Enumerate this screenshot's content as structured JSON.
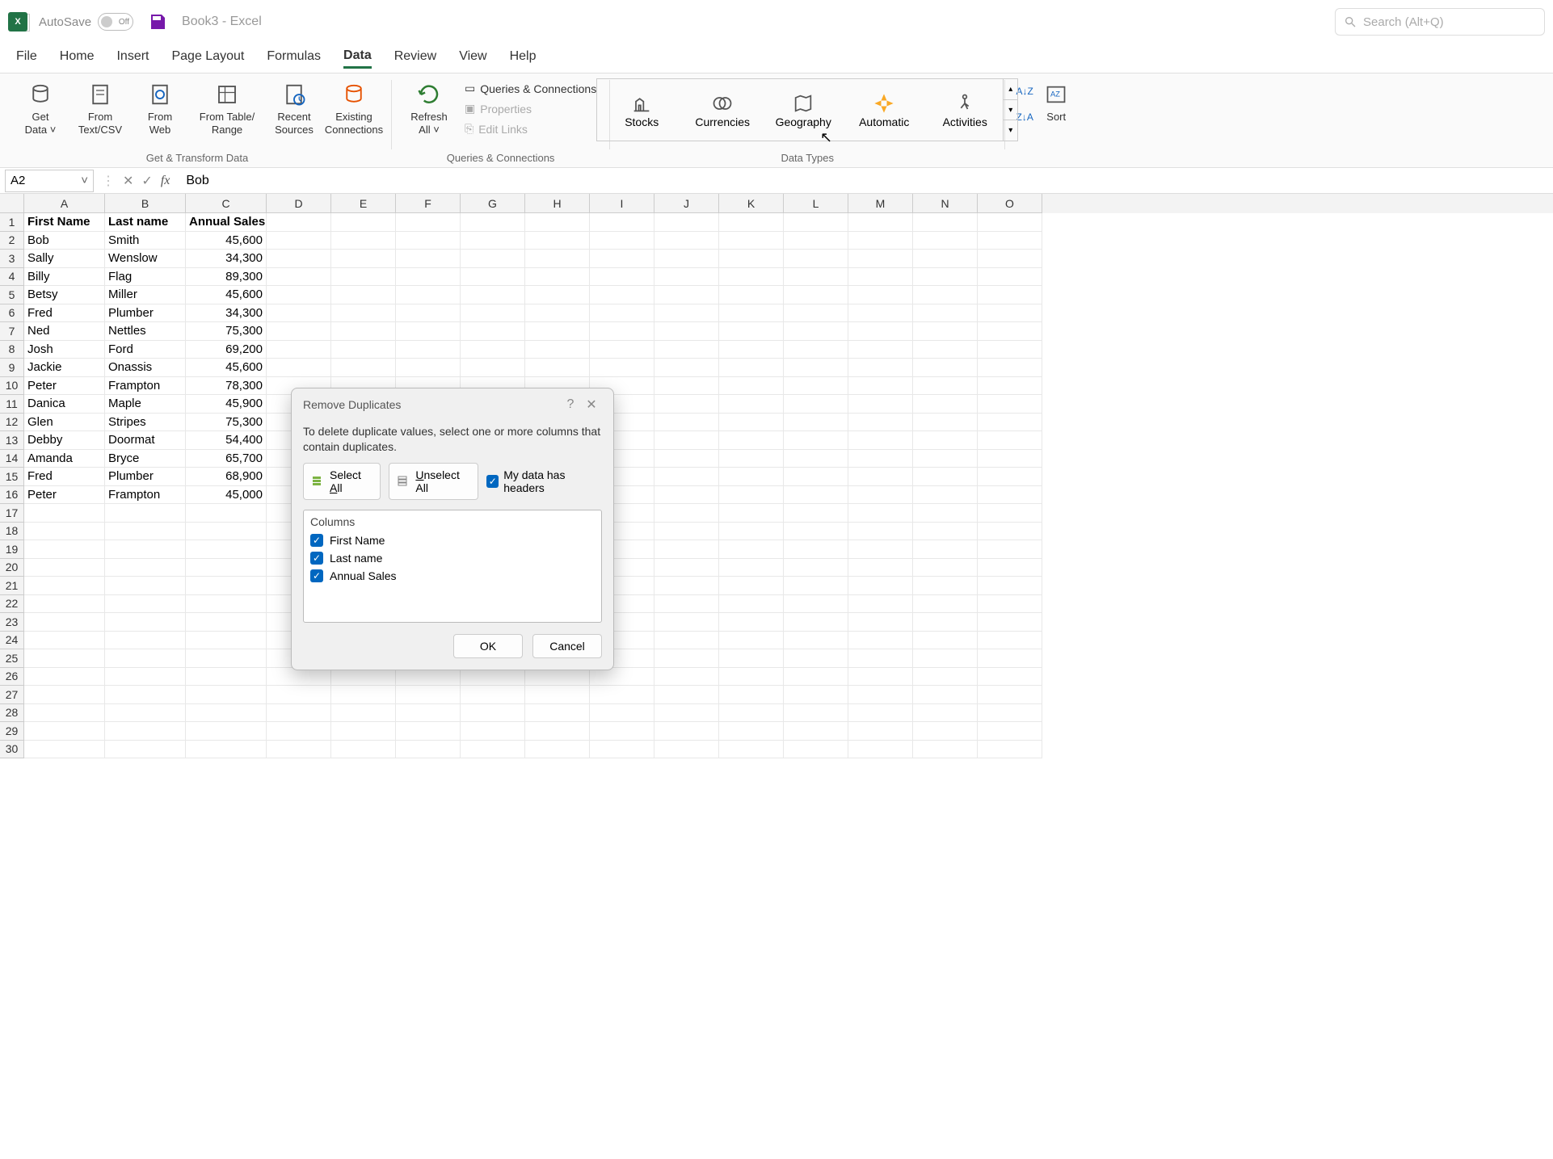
{
  "title": {
    "autosave": "AutoSave",
    "toggle": "Off",
    "doc": "Book3  -  Excel"
  },
  "search": {
    "placeholder": "Search (Alt+Q)"
  },
  "tabs": [
    "File",
    "Home",
    "Insert",
    "Page Layout",
    "Formulas",
    "Data",
    "Review",
    "View",
    "Help"
  ],
  "active_tab": "Data",
  "ribbon": {
    "get_transform": {
      "label": "Get & Transform Data",
      "items": [
        {
          "l1": "Get",
          "l2": "Data ˅"
        },
        {
          "l1": "From",
          "l2": "Text/CSV"
        },
        {
          "l1": "From",
          "l2": "Web"
        },
        {
          "l1": "From Table/",
          "l2": "Range"
        },
        {
          "l1": "Recent",
          "l2": "Sources"
        },
        {
          "l1": "Existing",
          "l2": "Connections"
        }
      ]
    },
    "queries": {
      "label": "Queries & Connections",
      "refresh": {
        "l1": "Refresh",
        "l2": "All ˅"
      },
      "links": [
        "Queries & Connections",
        "Properties",
        "Edit Links"
      ]
    },
    "datatypes": {
      "label": "Data Types",
      "items": [
        "Stocks",
        "Currencies",
        "Geography",
        "Automatic",
        "Activities"
      ]
    },
    "sort": "Sort"
  },
  "namebox": "A2",
  "formula": "Bob",
  "columns": [
    "A",
    "B",
    "C",
    "D",
    "E",
    "F",
    "G",
    "H",
    "I",
    "J",
    "K",
    "L",
    "M",
    "N",
    "O"
  ],
  "headers": [
    "First Name",
    "Last name",
    "Annual Sales"
  ],
  "rows": [
    {
      "a": "Bob",
      "b": "Smith",
      "c": "45,600"
    },
    {
      "a": "Sally",
      "b": "Wenslow",
      "c": "34,300"
    },
    {
      "a": "Billy",
      "b": "Flag",
      "c": "89,300"
    },
    {
      "a": "Betsy",
      "b": "Miller",
      "c": "45,600"
    },
    {
      "a": "Fred",
      "b": "Plumber",
      "c": "34,300"
    },
    {
      "a": "Ned",
      "b": "Nettles",
      "c": "75,300"
    },
    {
      "a": "Josh",
      "b": "Ford",
      "c": "69,200"
    },
    {
      "a": "Jackie",
      "b": "Onassis",
      "c": "45,600"
    },
    {
      "a": "Peter",
      "b": "Frampton",
      "c": "78,300"
    },
    {
      "a": "Danica",
      "b": "Maple",
      "c": "45,900"
    },
    {
      "a": "Glen",
      "b": "Stripes",
      "c": "75,300"
    },
    {
      "a": "Debby",
      "b": "Doormat",
      "c": "54,400"
    },
    {
      "a": "Amanda",
      "b": "Bryce",
      "c": "65,700"
    },
    {
      "a": "Fred",
      "b": "Plumber",
      "c": "68,900"
    },
    {
      "a": "Peter",
      "b": "Frampton",
      "c": "45,000"
    }
  ],
  "blank_rows": 14,
  "dialog": {
    "title": "Remove Duplicates",
    "desc": "To delete duplicate values, select one or more columns that contain duplicates.",
    "select_all_pre": "Select ",
    "select_all_u": "A",
    "select_all_post": "ll",
    "unselect_all_pre": "",
    "unselect_all_u": "U",
    "unselect_all_post": "nselect All",
    "headers_chk": "My data has headers",
    "cols_label": "Columns",
    "cols": [
      "First Name",
      "Last name",
      "Annual Sales"
    ],
    "ok": "OK",
    "cancel": "Cancel"
  }
}
